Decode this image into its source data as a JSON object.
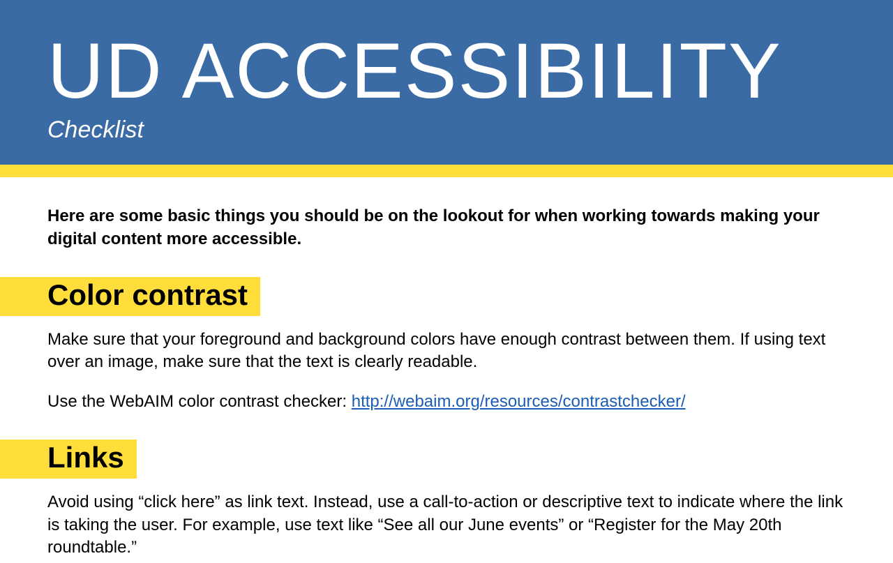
{
  "header": {
    "title": "UD ACCESSIBILITY",
    "subtitle": "Checklist"
  },
  "intro": "Here are some basic things you should be on the lookout for when working towards making your digital content more accessible.",
  "sections": [
    {
      "heading": "Color contrast",
      "para1": "Make sure that your foreground and background colors have enough contrast between them. If using text over an image, make sure that the text is clearly readable.",
      "para2_prefix": "Use the WebAIM color contrast checker: ",
      "link_text": "http://webaim.org/resources/contrastchecker/",
      "link_href": "http://webaim.org/resources/contrastchecker/"
    },
    {
      "heading": "Links",
      "para1": "Avoid using “click here” as link text. Instead, use a call-to-action or descriptive text to indicate where the link is taking the user. For example, use text like “See all our June events” or “Register for the May 20th roundtable.”"
    }
  ]
}
